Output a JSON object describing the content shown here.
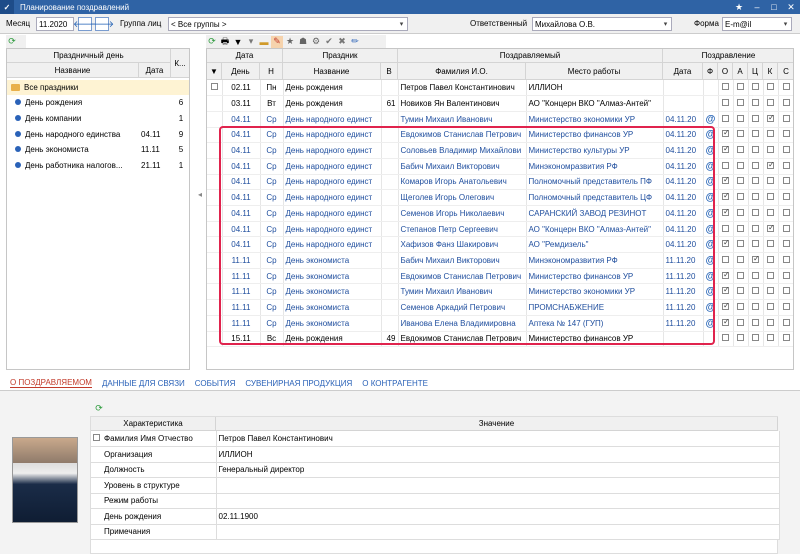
{
  "window": {
    "title": "Планирование поздравлений"
  },
  "toolbar": {
    "month_label": "Месяц",
    "month_value": "11.2020",
    "group_label": "Группа лиц",
    "group_value": "< Все группы >",
    "responsible_label": "Ответственный",
    "responsible_value": "Михайлова О.В.",
    "form_label": "Форма",
    "form_value": "E-m@il"
  },
  "left": {
    "header_group": "Праздничный день",
    "headers": [
      "Название",
      "Дата",
      "К..."
    ],
    "root": "Все праздники",
    "items": [
      {
        "name": "День рождения",
        "date": "",
        "count": "6"
      },
      {
        "name": "День компании",
        "date": "",
        "count": "1"
      },
      {
        "name": "День народного единства",
        "date": "04.11",
        "count": "9"
      },
      {
        "name": "День экономиста",
        "date": "11.11",
        "count": "5"
      },
      {
        "name": "День работника налогов...",
        "date": "21.11",
        "count": "1"
      }
    ]
  },
  "grid": {
    "groups": {
      "date": "Дата",
      "holiday": "Праздник",
      "person": "Поздравляемый",
      "congrats": "Поздравление"
    },
    "headers": [
      "День",
      "Н",
      "Название",
      "В",
      "Фамилия И.О.",
      "Место работы",
      "Дата",
      "Ф",
      "О",
      "А",
      "Ц",
      "К",
      "С"
    ],
    "rows": [
      {
        "d": "02.11",
        "w": "Пн",
        "h": "День рождения",
        "y": "",
        "fio": "Петров Павел Константинович",
        "org": "ИЛЛИОН",
        "cd": "",
        "f": "",
        "sel": true,
        "boxes": [
          false,
          false,
          false,
          false,
          false
        ],
        "hl": false
      },
      {
        "d": "03.11",
        "w": "Вт",
        "h": "День рождения",
        "y": "61",
        "fio": "Новиков Ян Валентинович",
        "org": "АО \"Концерн ВКО \"Алмаз-Антей\"",
        "cd": "",
        "f": "",
        "sel": false,
        "boxes": [
          false,
          false,
          false,
          false,
          false
        ],
        "hl": false
      },
      {
        "d": "04.11",
        "w": "Ср",
        "h": "День народного единст",
        "y": "",
        "fio": "Тумин Михаил Иванович",
        "org": "Министерство экономики УР",
        "cd": "04.11.20",
        "f": "@",
        "sel": false,
        "boxes": [
          false,
          false,
          false,
          true,
          false
        ],
        "hl": true
      },
      {
        "d": "04.11",
        "w": "Ср",
        "h": "День народного единст",
        "y": "",
        "fio": "Евдокимов Станислав Петрович",
        "org": "Министерство финансов УР",
        "cd": "04.11.20",
        "f": "@",
        "sel": false,
        "boxes": [
          true,
          false,
          false,
          false,
          false
        ],
        "hl": true
      },
      {
        "d": "04.11",
        "w": "Ср",
        "h": "День народного единст",
        "y": "",
        "fio": "Соловьев Владимир Михайлови",
        "org": "Министерство культуры УР",
        "cd": "04.11.20",
        "f": "@",
        "sel": false,
        "boxes": [
          true,
          false,
          false,
          false,
          false
        ],
        "hl": true
      },
      {
        "d": "04.11",
        "w": "Ср",
        "h": "День народного единст",
        "y": "",
        "fio": "Бабич Михаил Викторович",
        "org": "Минэкономразвития РФ",
        "cd": "04.11.20",
        "f": "@",
        "sel": false,
        "boxes": [
          false,
          false,
          false,
          true,
          false
        ],
        "hl": true
      },
      {
        "d": "04.11",
        "w": "Ср",
        "h": "День народного единст",
        "y": "",
        "fio": "Комаров Игорь Анатольевич",
        "org": "Полномочный представитель ПФ",
        "cd": "04.11.20",
        "f": "@",
        "sel": false,
        "boxes": [
          true,
          false,
          false,
          false,
          false
        ],
        "hl": true
      },
      {
        "d": "04.11",
        "w": "Ср",
        "h": "День народного единст",
        "y": "",
        "fio": "Щеголев Игорь Олегович",
        "org": "Полномочный представитель ЦФ",
        "cd": "04.11.20",
        "f": "@",
        "sel": false,
        "boxes": [
          true,
          false,
          false,
          false,
          false
        ],
        "hl": true
      },
      {
        "d": "04.11",
        "w": "Ср",
        "h": "День народного единст",
        "y": "",
        "fio": "Семенов Игорь Николаевич",
        "org": "САРАНСКИЙ ЗАВОД РЕЗИНОТ",
        "cd": "04.11.20",
        "f": "@",
        "sel": false,
        "boxes": [
          true,
          false,
          false,
          false,
          false
        ],
        "hl": true
      },
      {
        "d": "04.11",
        "w": "Ср",
        "h": "День народного единст",
        "y": "",
        "fio": "Степанов Петр Сергеевич",
        "org": "АО \"Концерн ВКО \"Алмаз-Антей\"",
        "cd": "04.11.20",
        "f": "@",
        "sel": false,
        "boxes": [
          false,
          false,
          false,
          true,
          false
        ],
        "hl": true
      },
      {
        "d": "04.11",
        "w": "Ср",
        "h": "День народного единст",
        "y": "",
        "fio": "Хафизов Фанз Шакирович",
        "org": "АО \"Ремдизель\"",
        "cd": "04.11.20",
        "f": "@",
        "sel": false,
        "boxes": [
          true,
          false,
          false,
          false,
          false
        ],
        "hl": true
      },
      {
        "d": "11.11",
        "w": "Ср",
        "h": "День экономиста",
        "y": "",
        "fio": "Бабич Михаил Викторович",
        "org": "Минэкономразвития РФ",
        "cd": "11.11.20",
        "f": "@",
        "sel": false,
        "boxes": [
          false,
          false,
          true,
          false,
          false
        ],
        "hl": true
      },
      {
        "d": "11.11",
        "w": "Ср",
        "h": "День экономиста",
        "y": "",
        "fio": "Евдокимов Станислав Петрович",
        "org": "Министерство финансов УР",
        "cd": "11.11.20",
        "f": "@",
        "sel": false,
        "boxes": [
          true,
          false,
          false,
          false,
          false
        ],
        "hl": true
      },
      {
        "d": "11.11",
        "w": "Ср",
        "h": "День экономиста",
        "y": "",
        "fio": "Тумин Михаил Иванович",
        "org": "Министерство экономики УР",
        "cd": "11.11.20",
        "f": "@",
        "sel": false,
        "boxes": [
          true,
          false,
          false,
          false,
          false
        ],
        "hl": true
      },
      {
        "d": "11.11",
        "w": "Ср",
        "h": "День экономиста",
        "y": "",
        "fio": "Семенов Аркадий Петрович",
        "org": "ПРОМСНАБЖЕНИЕ",
        "cd": "11.11.20",
        "f": "@",
        "sel": false,
        "boxes": [
          true,
          false,
          false,
          false,
          false
        ],
        "hl": true
      },
      {
        "d": "11.11",
        "w": "Ср",
        "h": "День экономиста",
        "y": "",
        "fio": "Иванова Елена Владимировна",
        "org": "Аптека № 147 (ГУП)",
        "cd": "11.11.20",
        "f": "@",
        "sel": false,
        "boxes": [
          true,
          false,
          false,
          false,
          false
        ],
        "hl": true
      },
      {
        "d": "15.11",
        "w": "Вс",
        "h": "День рождения",
        "y": "49",
        "fio": "Евдокимов Станислав Петрович",
        "org": "Министерство финансов УР",
        "cd": "",
        "f": "",
        "sel": false,
        "boxes": [
          false,
          false,
          false,
          false,
          false
        ],
        "hl": false
      }
    ]
  },
  "tabs": [
    "О ПОЗДРАВЛЯЕМОМ",
    "ДАННЫЕ ДЛЯ СВЯЗИ",
    "СОБЫТИЯ",
    "СУВЕНИРНАЯ ПРОДУКЦИЯ",
    "О КОНТРАГЕНТЕ"
  ],
  "props": {
    "headers": [
      "Характеристика",
      "Значение"
    ],
    "rows": [
      {
        "k": "Фамилия Имя Отчество",
        "v": "Петров Павел Константинович"
      },
      {
        "k": "Организация",
        "v": "ИЛЛИОН"
      },
      {
        "k": "Должность",
        "v": "Генеральный директор"
      },
      {
        "k": "Уровень в структуре",
        "v": ""
      },
      {
        "k": "Режим работы",
        "v": ""
      },
      {
        "k": "День рождения",
        "v": "02.11.1900"
      },
      {
        "k": "Примечания",
        "v": ""
      }
    ]
  },
  "colors": {
    "accent": "#2f63a5",
    "highlight": "#e0234d",
    "link": "#1f4e9e"
  }
}
